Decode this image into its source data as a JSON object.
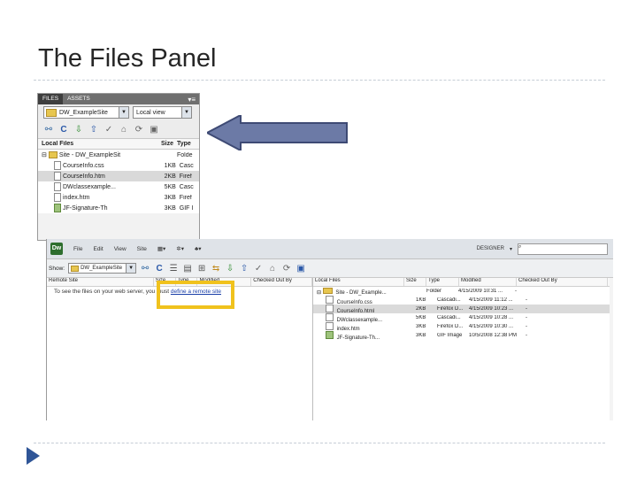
{
  "slide": {
    "title": "The Files Panel"
  },
  "colors": {
    "arrow": "#6c7aa6",
    "highlight": "#f0c21d",
    "bullet": "#2f5597"
  },
  "files_panel": {
    "tabs": [
      "FILES",
      "ASSETS"
    ],
    "menu_icon": "panel-menu-icon",
    "site_select": "DW_ExampleSite",
    "view_select": "Local view",
    "columns": {
      "name": "Local Files",
      "size": "Size",
      "type": "Type"
    },
    "rows": [
      {
        "name": "Site - DW_ExampleSit",
        "size": "",
        "type": "Folde",
        "icon": "folder-icon"
      },
      {
        "name": "CourseInfo.css",
        "size": "1KB",
        "type": "Casc",
        "icon": "page-icon"
      },
      {
        "name": "CourseInfo.htm",
        "size": "2KB",
        "type": "Firef",
        "icon": "page-icon"
      },
      {
        "name": "DWclassexample...",
        "size": "5KB",
        "type": "Casc",
        "icon": "page-icon"
      },
      {
        "name": "index.htm",
        "size": "3KB",
        "type": "Firef",
        "icon": "page-icon"
      },
      {
        "name": "JF-Signature-Th",
        "size": "3KB",
        "type": "GIF I",
        "icon": "image-icon"
      }
    ]
  },
  "dw_window": {
    "logo": "Dw",
    "menus": [
      "File",
      "Edit",
      "View",
      "Site"
    ],
    "workspace": "DESIGNER",
    "view_label": "Show:",
    "site_select": "DW_ExampleSite",
    "remote_columns": [
      "Remote Site",
      "Size",
      "Type",
      "Modified",
      "Checked Out By"
    ],
    "remote_message": "To see the files on your web server, you must",
    "remote_link": "define a remote site",
    "local_columns": [
      "Local Files",
      "Size",
      "Type",
      "Modified",
      "Checked Out By"
    ],
    "local_rows": [
      {
        "name": "Site - DW_Example...",
        "size": "",
        "type": "Folder",
        "modified": "4/15/2009 10:31 ...",
        "by": "-"
      },
      {
        "name": "CourseInfo.css",
        "size": "1KB",
        "type": "Cascadi...",
        "modified": "4/15/2009 11:12 ...",
        "by": "-"
      },
      {
        "name": "CourseInfo.html",
        "size": "2KB",
        "type": "Firefox D...",
        "modified": "4/15/2009 10:23 ...",
        "by": "-"
      },
      {
        "name": "DWclassexample...",
        "size": "5KB",
        "type": "Cascadi...",
        "modified": "4/15/2009 10:28 ...",
        "by": "-"
      },
      {
        "name": "index.htm",
        "size": "3KB",
        "type": "Firefox D...",
        "modified": "4/15/2009 10:30 ...",
        "by": "-"
      },
      {
        "name": "JF-Signature-Th...",
        "size": "3KB",
        "type": "GIF Image",
        "modified": "10/5/2008 12:38 PM",
        "by": "-"
      }
    ]
  }
}
